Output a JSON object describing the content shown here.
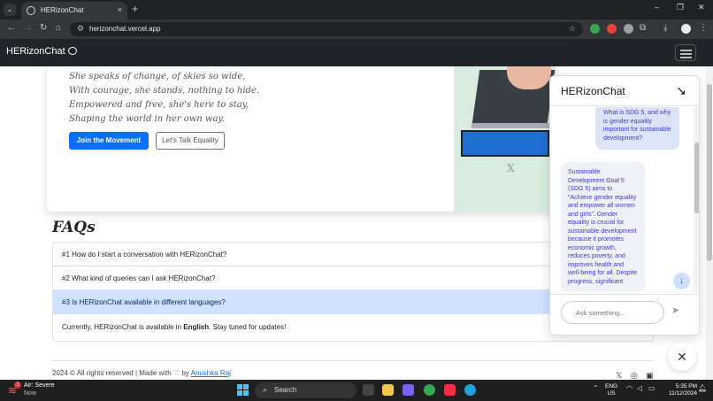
{
  "browser": {
    "tab_title": "HERizonChat",
    "url": "herizonchat.vercel.app",
    "tab_close": "×",
    "new_tab": "+",
    "minimize": "–",
    "restore": "❐",
    "close": "✕"
  },
  "navbar": {
    "brand": "HERizonChat"
  },
  "hero": {
    "poem": [
      "She speaks of change, of skies so wide,",
      "With courage, she stands, nothing to hide.",
      "Empowered and free, she's here to stay,",
      "Shaping the world in her own way."
    ],
    "primary_button": "Join the Movement",
    "secondary_button": "Let's Talk Equality",
    "image_glyph": "X"
  },
  "faq": {
    "title": "FAQs",
    "items": [
      "#1 How do I start a conversation with HERizonChat?",
      "#2 What kind of queries can I ask HERizonChat?",
      "#3 Is HERizonChat available in different languages?"
    ],
    "answer_prefix": "Currently, HERizonChat is available in ",
    "answer_bold": "English",
    "answer_suffix": ". Stay tuned for updates!"
  },
  "footer": {
    "text_before": "2024 © All rights reserved | Made with ",
    "heart": "♡",
    "by": " by ",
    "author": "Anushka Raj"
  },
  "chat": {
    "title": "HERizonChat",
    "user_message": "What is SDG 5, and why is gender equality important for sustainable development?",
    "bot_message": "Sustainable Development Goal 5 (SDG 5) aims to \"Achieve gender equality and empower all women and girls\". Gender equality is crucial for sustainable development because it promotes economic growth, reduces poverty, and improves health and well-being for all. Despite progress, significant",
    "input_placeholder": "Ask something..."
  },
  "taskbar": {
    "weather_title": "Air: Severe",
    "weather_sub": "Now",
    "weather_badge": "1",
    "search": "Search",
    "lang_line1": "ENG",
    "lang_line2": "US",
    "time": "5:35 PM",
    "date": "11/12/2024"
  }
}
